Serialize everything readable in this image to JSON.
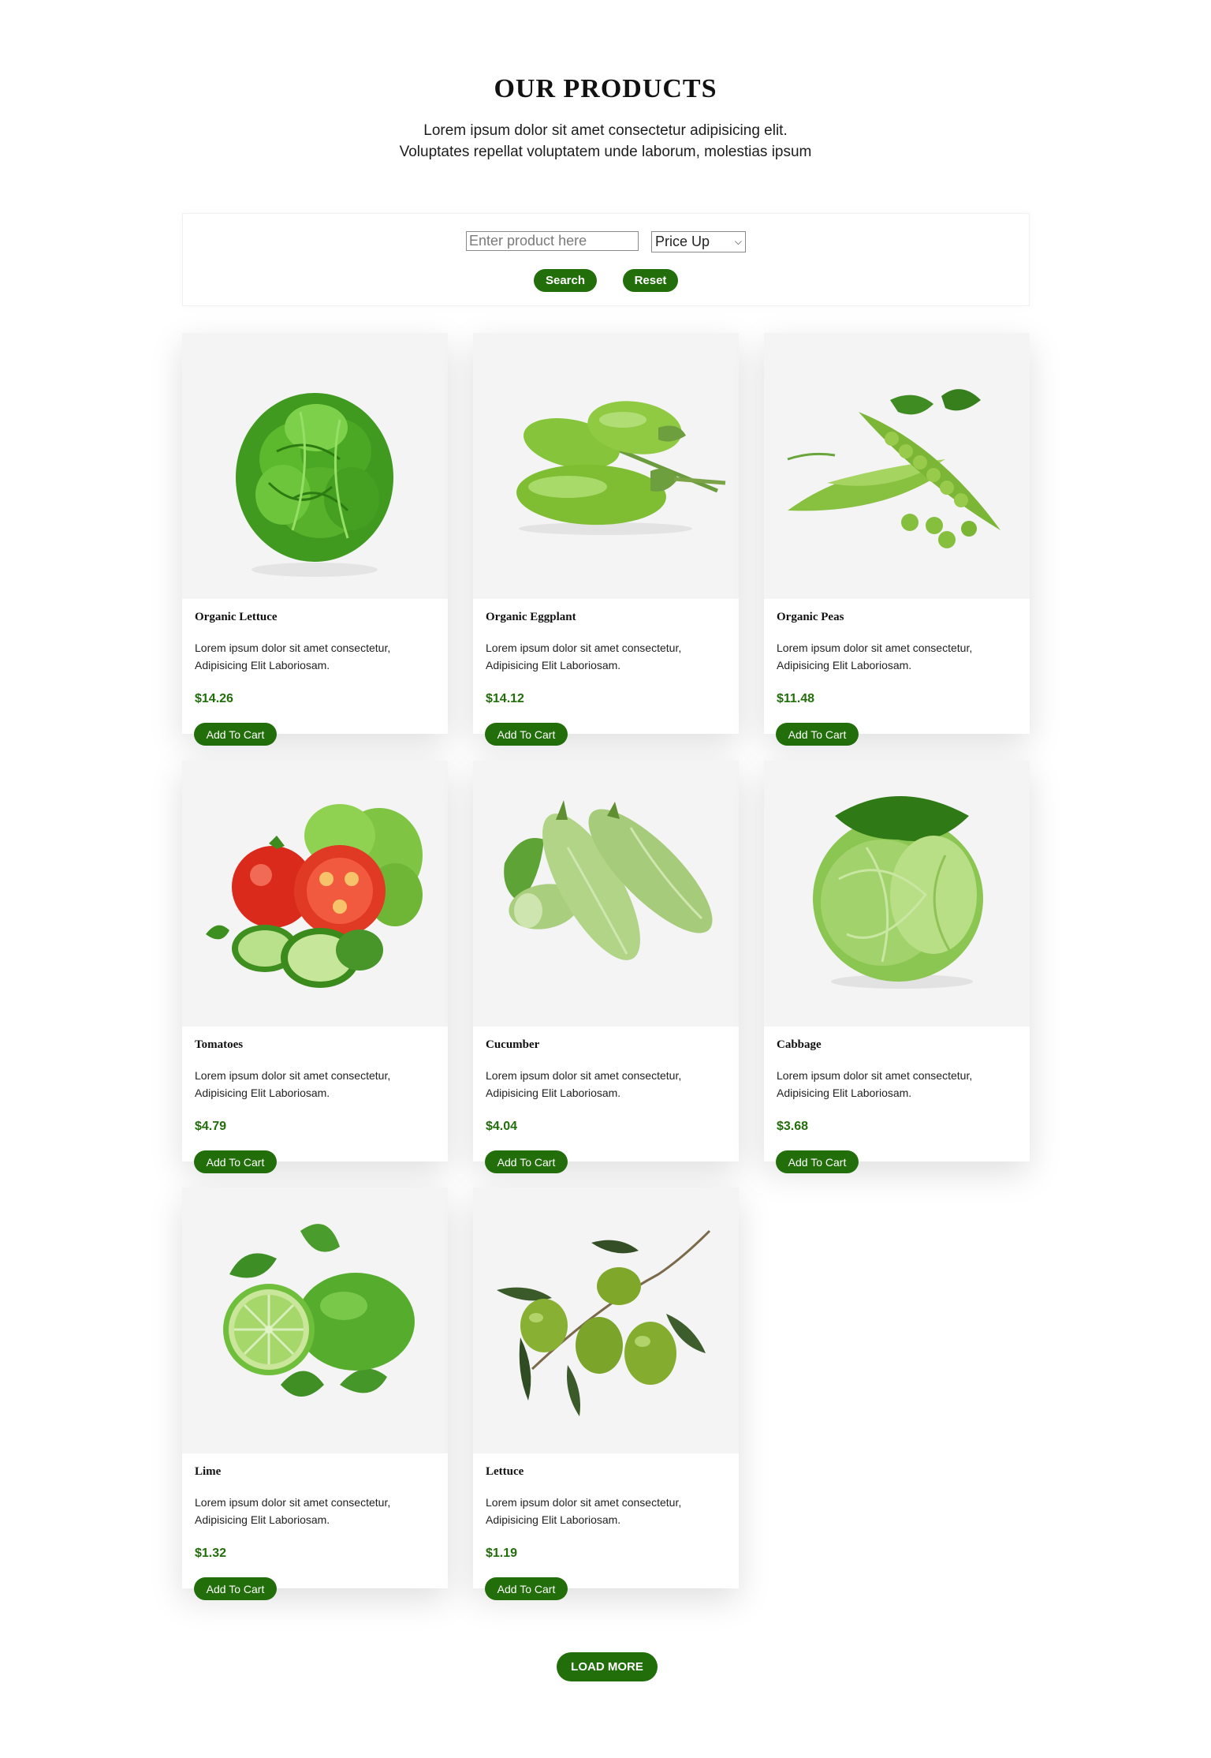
{
  "header": {
    "title": "OUR PRODUCTS",
    "subtitle_line1": "Lorem ipsum dolor sit amet consectetur adipisicing elit.",
    "subtitle_line2": "Voluptates repellat voluptatem unde laborum, molestias ipsum"
  },
  "filter": {
    "search_placeholder": "Enter product here",
    "search_value": "",
    "sort_selected": "Price Up",
    "search_button": "Search",
    "reset_button": "Reset"
  },
  "products": [
    {
      "name": "Organic Lettuce",
      "desc_line1": "Lorem ipsum dolor sit amet consectetur,",
      "desc_line2": "Adipisicing Elit Laboriosam.",
      "price": "$14.26",
      "cart_label": "Add To Cart",
      "image": "lettuce"
    },
    {
      "name": "Organic Eggplant",
      "desc_line1": "Lorem ipsum dolor sit amet consectetur,",
      "desc_line2": "Adipisicing Elit Laboriosam.",
      "price": "$14.12",
      "cart_label": "Add To Cart",
      "image": "green-eggplant"
    },
    {
      "name": "Organic Peas",
      "desc_line1": "Lorem ipsum dolor sit amet consectetur,",
      "desc_line2": "Adipisicing Elit Laboriosam.",
      "price": "$11.48",
      "cart_label": "Add To Cart",
      "image": "peas"
    },
    {
      "name": "Tomatoes",
      "desc_line1": "Lorem ipsum dolor sit amet consectetur,",
      "desc_line2": "Adipisicing Elit Laboriosam.",
      "price": "$4.79",
      "cart_label": "Add To Cart",
      "image": "tomatoes-cucumber"
    },
    {
      "name": "Cucumber",
      "desc_line1": "Lorem ipsum dolor sit amet consectetur,",
      "desc_line2": "Adipisicing Elit Laboriosam.",
      "price": "$4.04",
      "cart_label": "Add To Cart",
      "image": "zucchini"
    },
    {
      "name": "Cabbage",
      "desc_line1": "Lorem ipsum dolor sit amet consectetur,",
      "desc_line2": "Adipisicing Elit Laboriosam.",
      "price": "$3.68",
      "cart_label": "Add To Cart",
      "image": "cabbage"
    },
    {
      "name": "Lime",
      "desc_line1": "Lorem ipsum dolor sit amet consectetur,",
      "desc_line2": "Adipisicing Elit Laboriosam.",
      "price": "$1.32",
      "cart_label": "Add To Cart",
      "image": "lime"
    },
    {
      "name": "Lettuce",
      "desc_line1": "Lorem ipsum dolor sit amet consectetur,",
      "desc_line2": "Adipisicing Elit Laboriosam.",
      "price": "$1.19",
      "cart_label": "Add To Cart",
      "image": "olives"
    }
  ],
  "load_more": "LOAD MORE",
  "colors": {
    "accent": "#216e0a",
    "image_bg": "#f4f4f4"
  }
}
